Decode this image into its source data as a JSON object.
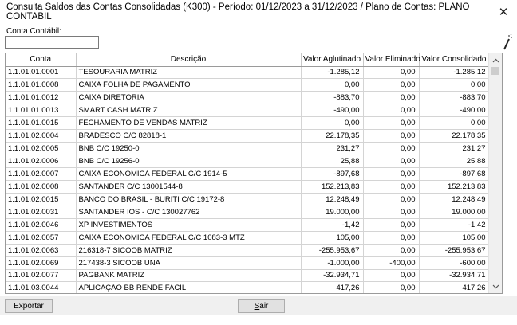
{
  "window": {
    "title": "Consulta Saldos das Contas Consolidadas (K300) - Período: 01/12/2023 a 31/12/2023 / Plano de Contas: PLANO CONTABIL",
    "close_glyph": "✕"
  },
  "filter": {
    "label": "Conta Contábil:",
    "value": ""
  },
  "table": {
    "columns": [
      "Conta",
      "Descrição",
      "Valor Aglutinado",
      "Valor Eliminado",
      "Valor Consolidado"
    ],
    "rows": [
      [
        "1.1.01.01.0001",
        "TESOURARIA MATRIZ",
        "-1.285,12",
        "0,00",
        "-1.285,12"
      ],
      [
        "1.1.01.01.0008",
        "CAIXA FOLHA DE PAGAMENTO",
        "0,00",
        "0,00",
        "0,00"
      ],
      [
        "1.1.01.01.0012",
        "CAIXA DIRETORIA",
        "-883,70",
        "0,00",
        "-883,70"
      ],
      [
        "1.1.01.01.0013",
        "SMART CASH MATRIZ",
        "-490,00",
        "0,00",
        "-490,00"
      ],
      [
        "1.1.01.01.0015",
        "FECHAMENTO DE VENDAS MATRIZ",
        "0,00",
        "0,00",
        "0,00"
      ],
      [
        "1.1.01.02.0004",
        "BRADESCO C/C 82818-1",
        "22.178,35",
        "0,00",
        "22.178,35"
      ],
      [
        "1.1.01.02.0005",
        "BNB C/C 19250-0",
        "231,27",
        "0,00",
        "231,27"
      ],
      [
        "1.1.01.02.0006",
        "BNB C/C 19256-0",
        "25,88",
        "0,00",
        "25,88"
      ],
      [
        "1.1.01.02.0007",
        "CAIXA ECONOMICA FEDERAL C/C 1914-5",
        "-897,68",
        "0,00",
        "-897,68"
      ],
      [
        "1.1.01.02.0008",
        "SANTANDER C/C 13001544-8",
        "152.213,83",
        "0,00",
        "152.213,83"
      ],
      [
        "1.1.01.02.0015",
        "BANCO DO BRASIL - BURITI C/C 19172-8",
        "12.248,49",
        "0,00",
        "12.248,49"
      ],
      [
        "1.1.01.02.0031",
        "SANTANDER IOS - C/C 130027762",
        "19.000,00",
        "0,00",
        "19.000,00"
      ],
      [
        "1.1.01.02.0046",
        "XP INVESTIMENTOS",
        "-1,42",
        "0,00",
        "-1,42"
      ],
      [
        "1.1.01.02.0057",
        "CAIXA ECONOMICA FEDERAL C/C 1083-3 MTZ",
        "105,00",
        "0,00",
        "105,00"
      ],
      [
        "1.1.01.02.0063",
        "216318-7 SICOOB MATRIZ",
        "-255.953,67",
        "0,00",
        "-255.953,67"
      ],
      [
        "1.1.01.02.0069",
        "217438-3 SICOOB UNA",
        "-1.000,00",
        "-400,00",
        "-600,00"
      ],
      [
        "1.1.01.02.0077",
        "PAGBANK MATRIZ",
        "-32.934,71",
        "0,00",
        "-32.934,71"
      ],
      [
        "1.1.01.03.0044",
        "APLICAÇÃO BB RENDE FACIL",
        "417,26",
        "0,00",
        "417,26"
      ]
    ]
  },
  "buttons": {
    "export_label": "Exportar",
    "exit_mnemonic": "S",
    "exit_rest": "air"
  },
  "icons": {
    "magic_wand": "magic-wand-icon",
    "scroll_up": "chevron-up-icon",
    "scroll_down": "chevron-down-icon"
  }
}
